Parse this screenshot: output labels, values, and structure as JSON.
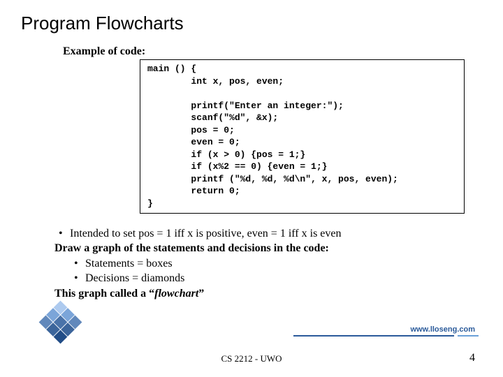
{
  "title": "Program Flowcharts",
  "subtitle": "Example of code:",
  "code": "main () {\n        int x, pos, even;\n\n        printf(\"Enter an integer:\");\n        scanf(\"%d\", &x);\n        pos = 0;\n        even = 0;\n        if (x > 0) {pos = 1;}\n        if (x%2 == 0) {even = 1;}\n        printf (\"%d, %d, %d\\n\", x, pos, even);\n        return 0;\n}",
  "bullets": {
    "b1": "Intended to set pos = 1 iff x is positive, even = 1 iff x is even",
    "line2": "Draw a graph of the statements and decisions in the code:",
    "b2": "Statements = boxes",
    "b3": "Decisions = diamonds",
    "line5a": "This graph called a “",
    "line5b": "flowchart",
    "line5c": "”"
  },
  "footer": {
    "url": "www.lloseng.com",
    "course": "CS 2212 - UWO",
    "page": "4"
  }
}
